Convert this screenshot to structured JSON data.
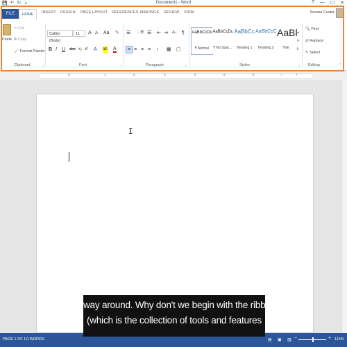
{
  "window": {
    "title": "Document1 - Word",
    "controls": [
      "?",
      "—",
      "☐",
      "✕"
    ]
  },
  "qat": {
    "save": "💾",
    "undo": "↶",
    "redo": "↻",
    "customize": "⇣"
  },
  "tabs": {
    "file": "FILE",
    "items": [
      "HOME",
      "INSERT",
      "DESIGN",
      "PAGE LAYOUT",
      "REFERENCES",
      "MAILINGS",
      "REVIEW",
      "VIEW"
    ]
  },
  "user": {
    "name": "Serene Custer"
  },
  "ribbon": {
    "clipboard": {
      "label": "Clipboard",
      "paste": "Paste",
      "cut": "Cut",
      "copy": "Copy",
      "format_painter": "Format Painter"
    },
    "font": {
      "label": "Font",
      "font_name": "Calibri (Body)",
      "font_size": "11",
      "grow": "A",
      "shrink": "A",
      "case": "Aa",
      "clear": "✎",
      "bold": "B",
      "italic": "I",
      "underline": "U",
      "strike": "abc",
      "subscript": "x₂",
      "superscript": "x²",
      "effects": "A",
      "highlight": "ab",
      "font_color": "A"
    },
    "paragraph": {
      "label": "Paragraph",
      "bullets": "☰",
      "numbering": "⋮☰",
      "multilevel": "☰",
      "decrease_indent": "⇤",
      "increase_indent": "⇥",
      "sort": "A↓",
      "show_marks": "¶",
      "align_left": "≡",
      "align_center": "≡",
      "align_right": "≡",
      "justify": "≡",
      "line_spacing": "↕",
      "shading": "▦",
      "borders": "▢"
    },
    "styles": {
      "label": "Styles",
      "items": [
        {
          "sample": "AaBbCcDc",
          "name": "¶ Normal"
        },
        {
          "sample": "AaBbCcDc",
          "name": "¶ No Spac..."
        },
        {
          "sample": "AaBbCc",
          "name": "Heading 1"
        },
        {
          "sample": "AaBbCcC",
          "name": "Heading 2"
        },
        {
          "sample": "AaBl",
          "name": "Title"
        }
      ]
    },
    "editing": {
      "label": "Editing",
      "find": "Find",
      "replace": "Replace",
      "select": "Select"
    }
  },
  "ruler": {
    "ticks": [
      "1",
      "2",
      "3",
      "4",
      "5",
      "6",
      "7"
    ]
  },
  "statusbar": {
    "page": "PAGE 1 OF 1",
    "words": "0 WORDS",
    "zoom": "116%"
  },
  "caption": {
    "line1": "way around. Why don't we begin with the ribbon",
    "line2": "(which is the collection of tools and features"
  },
  "colors": {
    "accent": "#2b579a",
    "highlight_frame": "#e8843a",
    "caption_bg": "#111111"
  }
}
